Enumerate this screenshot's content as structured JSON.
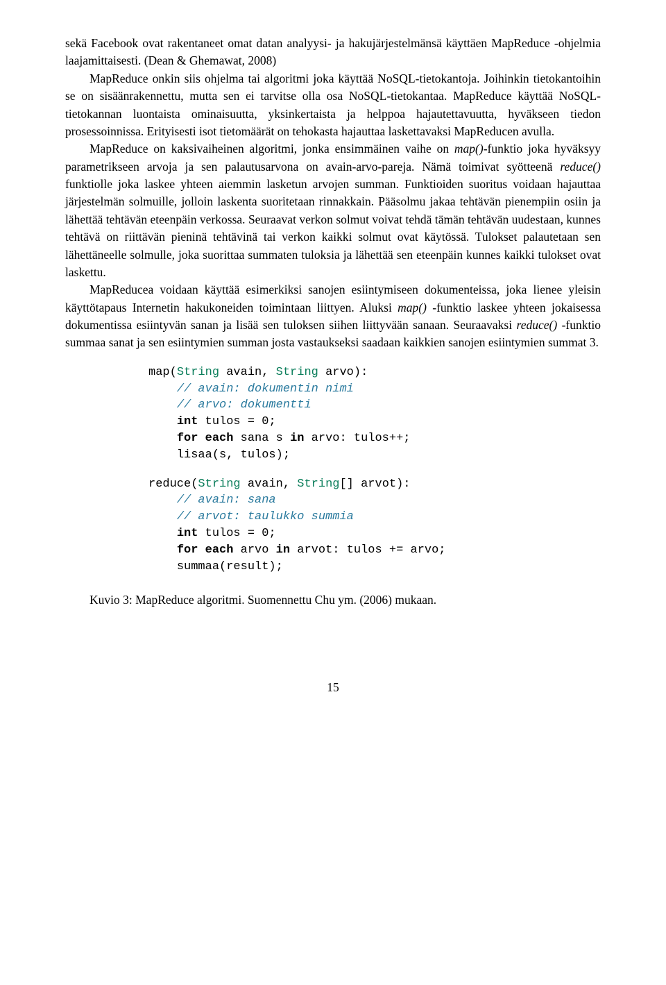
{
  "paragraphs": {
    "p1_part1": "sekä Facebook ovat rakentaneet omat datan analyysi- ja hakujärjestelmänsä käyttäen MapReduce -ohjelmia laajamittaisesti. (Dean & Ghemawat, 2008)",
    "p2_part1": "MapReduce onkin siis ohjelma tai algoritmi joka käyttää NoSQL-tietokantoja. Joihinkin tietokantoihin se on sisäänrakennettu, mutta sen ei tarvitse olla osa NoSQL-tietokantaa. MapReduce käyttää NoSQL-tietokannan luontaista ominaisuutta, yksinkertaista ja helppoa hajautettavuutta, hyväkseen tiedon prosessoinnissa. Erityisesti isot tietomäärät on tehokasta hajauttaa laskettavaksi MapReducen avulla.",
    "p3_part1": "MapReduce on kaksivaiheinen algoritmi, jonka ensimmäinen vaihe on ",
    "p3_italic1": "map()",
    "p3_part2": "-funktio joka hyväksyy parametrikseen arvoja ja sen palautusarvona on avain-arvo-pareja. Nämä toimivat syötteenä ",
    "p3_italic2": "reduce()",
    "p3_part3": " funktiolle joka laskee yhteen aiemmin lasketun arvojen summan. Funktioiden suoritus voidaan hajauttaa järjestelmän solmuille, jolloin laskenta suoritetaan rinnakkain. Pääsolmu jakaa tehtävän pienempiin osiin ja lähettää tehtävän eteenpäin verkossa. Seuraavat verkon solmut voivat tehdä tämän tehtävän uudestaan, kunnes tehtävä on riittävän pieninä tehtävinä tai verkon kaikki solmut ovat käytössä. Tulokset palautetaan sen lähettäneelle solmulle, joka suorittaa summaten tuloksia ja lähettää sen eteenpäin kunnes kaikki tulokset ovat laskettu.",
    "p4_part1": "MapReducea voidaan käyttää esimerkiksi sanojen esiintymiseen dokumenteissa, joka lienee yleisin käyttötapaus Internetin hakukoneiden toimintaan liittyen. Aluksi ",
    "p4_italic1": "map()",
    "p4_part2": " -funktio laskee yhteen jokaisessa dokumentissa esiintyvän sanan ja lisää sen tuloksen siihen liittyvään sanaan. Seuraavaksi ",
    "p4_italic2": "reduce()",
    "p4_part3": " -funktio summaa sanat ja sen esiintymien summan josta vastaukseksi saadaan kaikkien sanojen esiintymien summat 3."
  },
  "code": {
    "map_sig_1": "map(",
    "map_type": "String",
    "map_sig_2": " avain, ",
    "map_sig_3": " arvo):",
    "map_c1": "// avain: dokumentin nimi",
    "map_c2": "// arvo: dokumentti",
    "int_kw": "int",
    "map_line3": " tulos = 0;",
    "for_kw": "for",
    "each_kw": "each",
    "in_kw": "in",
    "map_line4a": " sana s ",
    "map_line4b": " arvo: tulos++;",
    "map_line5": "lisaa(s, tulos);",
    "reduce_sig_1": "reduce(",
    "reduce_sig_2": " avain, ",
    "reduce_sig_3": "[] arvot):",
    "reduce_c1": "// avain: sana",
    "reduce_c2": "// arvot: taulukko summia",
    "reduce_line3": " tulos = 0;",
    "reduce_line4a": " arvo ",
    "reduce_line4b": " arvot: tulos += arvo;",
    "reduce_line5": "summaa(result);"
  },
  "caption": "Kuvio 3: MapReduce algoritmi. Suomennettu Chu ym. (2006) mukaan.",
  "page_number": "15"
}
